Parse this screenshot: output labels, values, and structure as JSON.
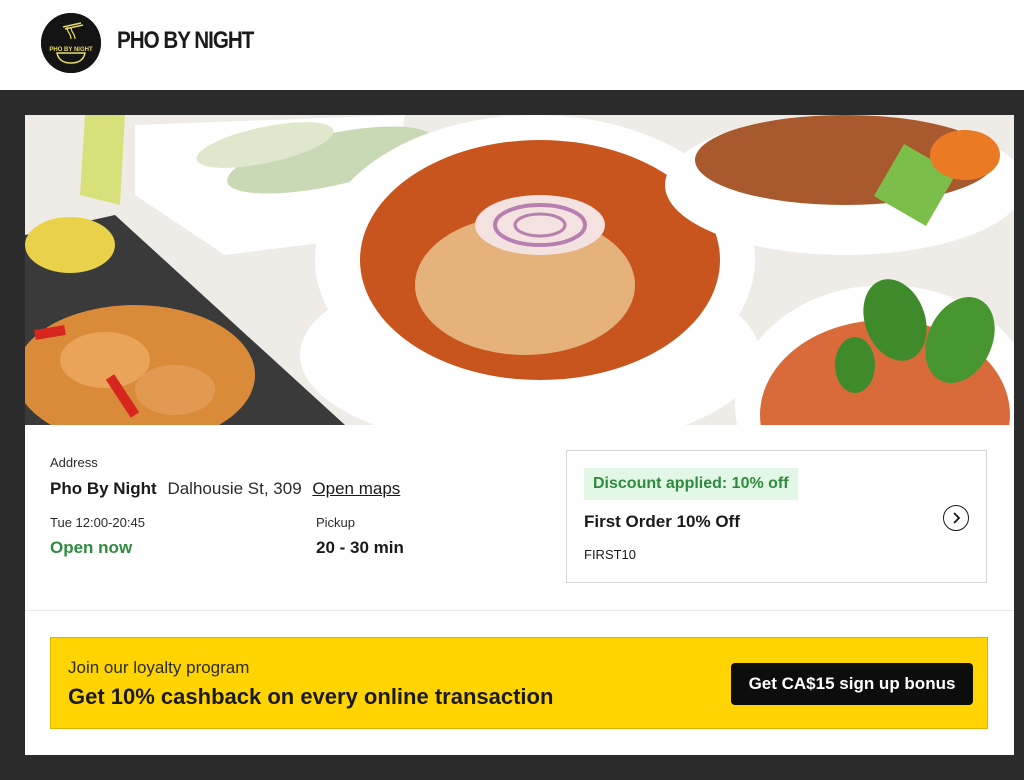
{
  "header": {
    "brand": "PHO BY NIGHT",
    "logo_text": "PHO BY NIGHT"
  },
  "restaurant": {
    "address_label": "Address",
    "name": "Pho By Night",
    "street": "Dalhousie St, 309",
    "maps_link": "Open maps",
    "hours": "Tue 12:00-20:45",
    "status": "Open now",
    "pickup_label": "Pickup",
    "pickup_time": "20 - 30 min"
  },
  "discount": {
    "badge": "Discount applied: 10% off",
    "title": "First Order 10% Off",
    "code": "FIRST10"
  },
  "loyalty": {
    "intro": "Join our loyalty program",
    "headline": "Get 10% cashback on every online transaction",
    "button": "Get CA$15 sign up bonus"
  },
  "colors": {
    "accent_yellow": "#ffd400",
    "open_green": "#2e8b3e",
    "badge_bg": "#e3f7e7",
    "dark": "#0d0d0d"
  }
}
